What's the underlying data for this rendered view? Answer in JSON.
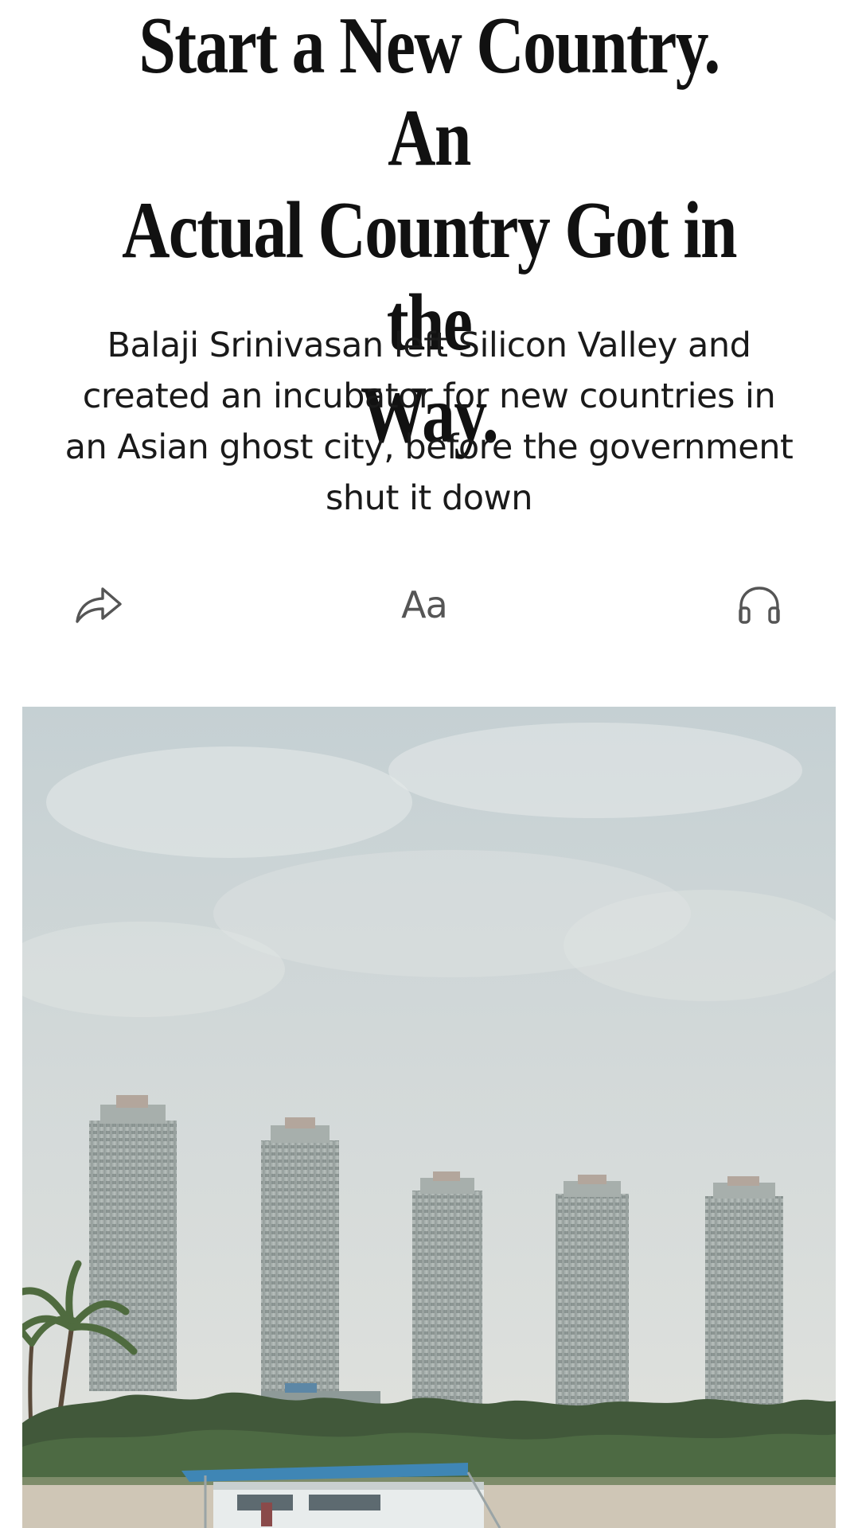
{
  "article": {
    "headline_line1": "Start a New Country. An",
    "headline_line2": "Actual Country Got in the",
    "headline_line3": "Way.",
    "dek_line1": "Balaji Srinivasan left Silicon Valley and",
    "dek_line2": "created an incubator for new countries in",
    "dek_line3": "an Asian ghost city, before the government",
    "dek_line4": "shut it down"
  },
  "toolbar": {
    "share_icon": "share-arrow-icon",
    "text_size_label": "Aa",
    "listen_icon": "headphones-icon"
  },
  "hero_image": {
    "description_icon": "photo"
  },
  "colors": {
    "text": "#111111",
    "icon": "#555555",
    "background": "#ffffff"
  }
}
